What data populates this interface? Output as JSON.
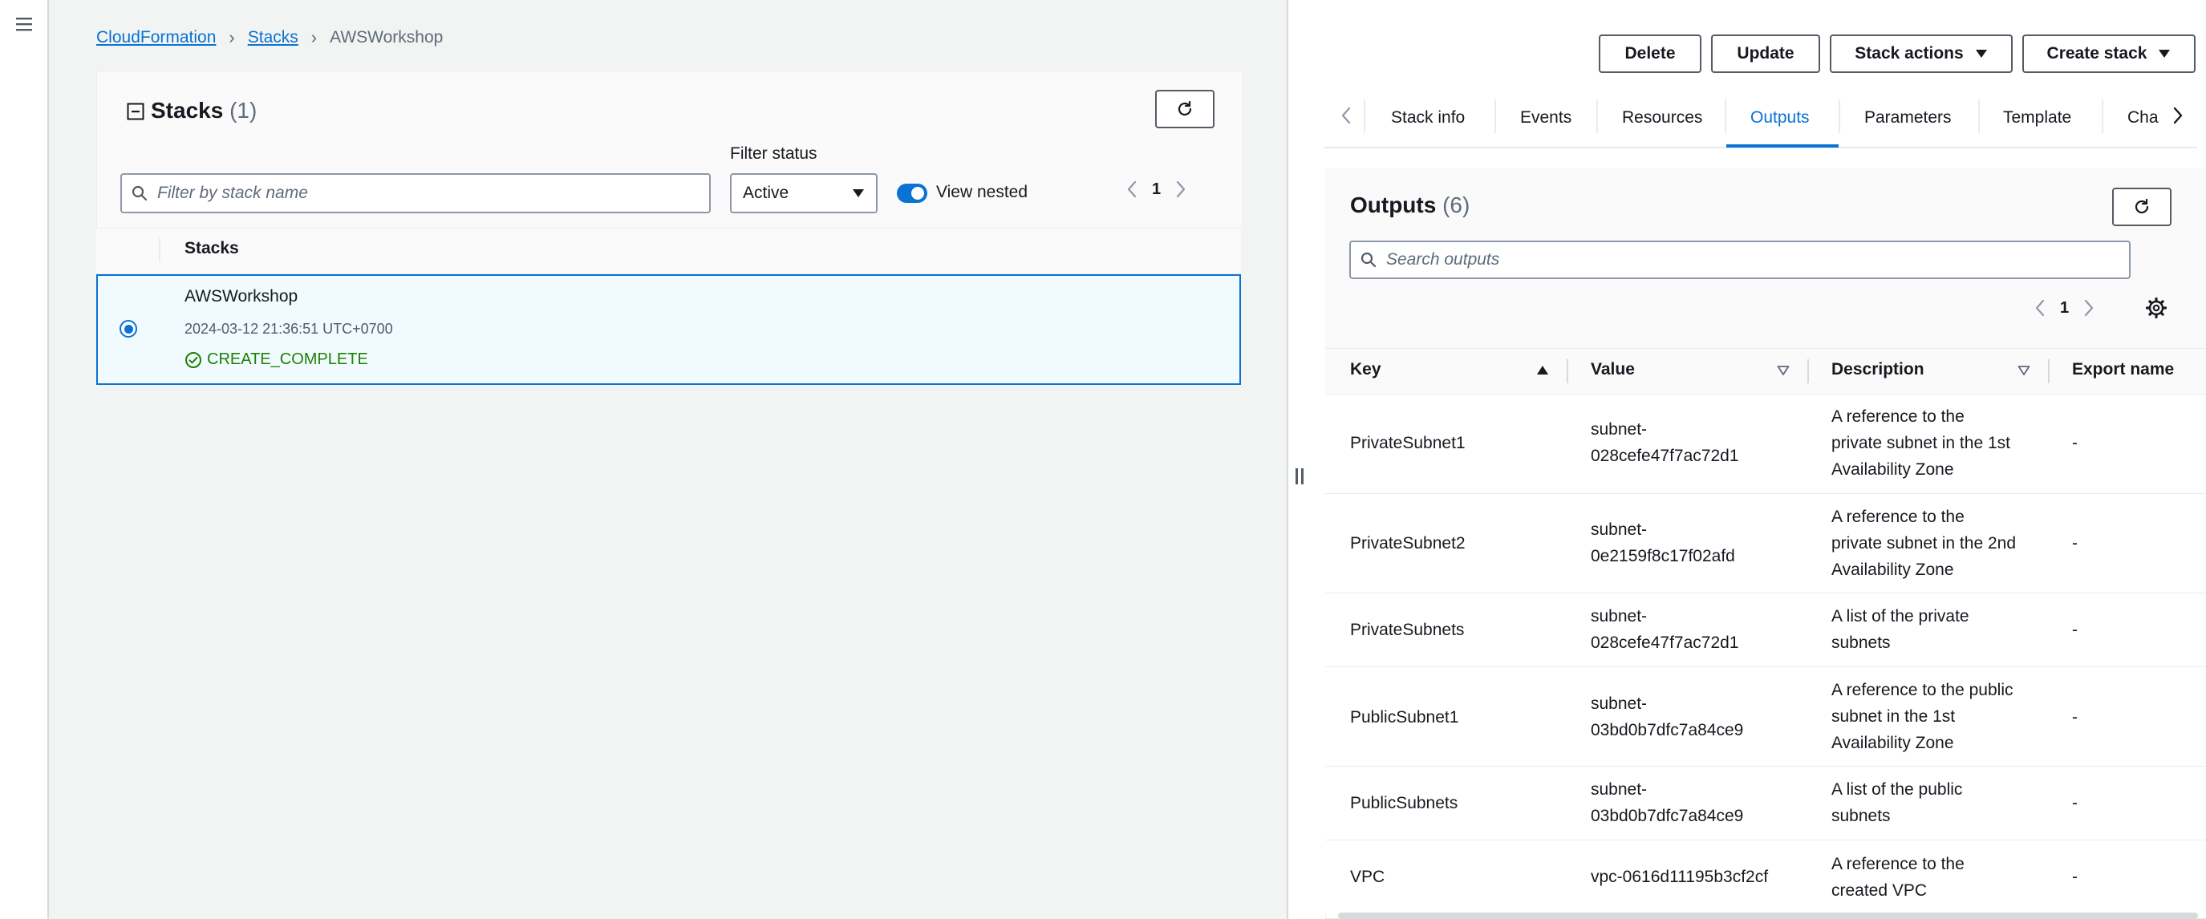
{
  "breadcrumb": {
    "items": [
      "CloudFormation",
      "Stacks"
    ],
    "current": "AWSWorkshop"
  },
  "stacks_panel": {
    "title": "Stacks",
    "count": "(1)",
    "filter_status_label": "Filter status",
    "search_placeholder": "Filter by stack name",
    "filter_value": "Active",
    "view_nested_label": "View nested",
    "page": "1",
    "column_header": "Stacks",
    "rows": [
      {
        "name": "AWSWorkshop",
        "timestamp": "2024-03-12 21:36:51 UTC+0700",
        "status": "CREATE_COMPLETE"
      }
    ]
  },
  "actions": {
    "delete": "Delete",
    "update": "Update",
    "stack_actions": "Stack actions",
    "create_stack": "Create stack"
  },
  "tabs": [
    "Stack info",
    "Events",
    "Resources",
    "Outputs",
    "Parameters",
    "Template",
    "Cha"
  ],
  "active_tab": "Outputs",
  "outputs": {
    "title": "Outputs",
    "count": "(6)",
    "search_placeholder": "Search outputs",
    "page": "1",
    "columns": [
      "Key",
      "Value",
      "Description",
      "Export name"
    ],
    "rows": [
      {
        "key": "PrivateSubnet1",
        "value": [
          "subnet-",
          "028cefe47f7ac72d1"
        ],
        "description": [
          "A reference to the",
          "private subnet in the 1st",
          "Availability Zone"
        ],
        "export": "-"
      },
      {
        "key": "PrivateSubnet2",
        "value": [
          "subnet-",
          "0e2159f8c17f02afd"
        ],
        "description": [
          "A reference to the",
          "private subnet in the 2nd",
          "Availability Zone"
        ],
        "export": "-"
      },
      {
        "key": "PrivateSubnets",
        "value": [
          "subnet-",
          "028cefe47f7ac72d1"
        ],
        "description": [
          "A list of the private",
          "subnets"
        ],
        "export": "-"
      },
      {
        "key": "PublicSubnet1",
        "value": [
          "subnet-",
          "03bd0b7dfc7a84ce9"
        ],
        "description": [
          "A reference to the public",
          "subnet in the 1st",
          "Availability Zone"
        ],
        "export": "-"
      },
      {
        "key": "PublicSubnets",
        "value": [
          "subnet-",
          "03bd0b7dfc7a84ce9"
        ],
        "description": [
          "A list of the public",
          "subnets"
        ],
        "export": "-"
      },
      {
        "key": "VPC",
        "value": [
          "vpc-0616d11195b3cf2cf"
        ],
        "description": [
          "A reference to the",
          "created VPC"
        ],
        "export": "-"
      }
    ]
  },
  "colors": {
    "link": "#0972d3",
    "success": "#1d8102",
    "selected_row_bg": "#f1faff",
    "text": "#16191f",
    "muted": "#5f6b7a"
  },
  "icons": [
    "menu-icon",
    "collapse-icon",
    "refresh-icon",
    "search-icon",
    "caret-down-icon",
    "chevron-left-icon",
    "chevron-right-icon",
    "success-icon",
    "settings-icon",
    "sort-asc-icon",
    "sort-icon"
  ]
}
